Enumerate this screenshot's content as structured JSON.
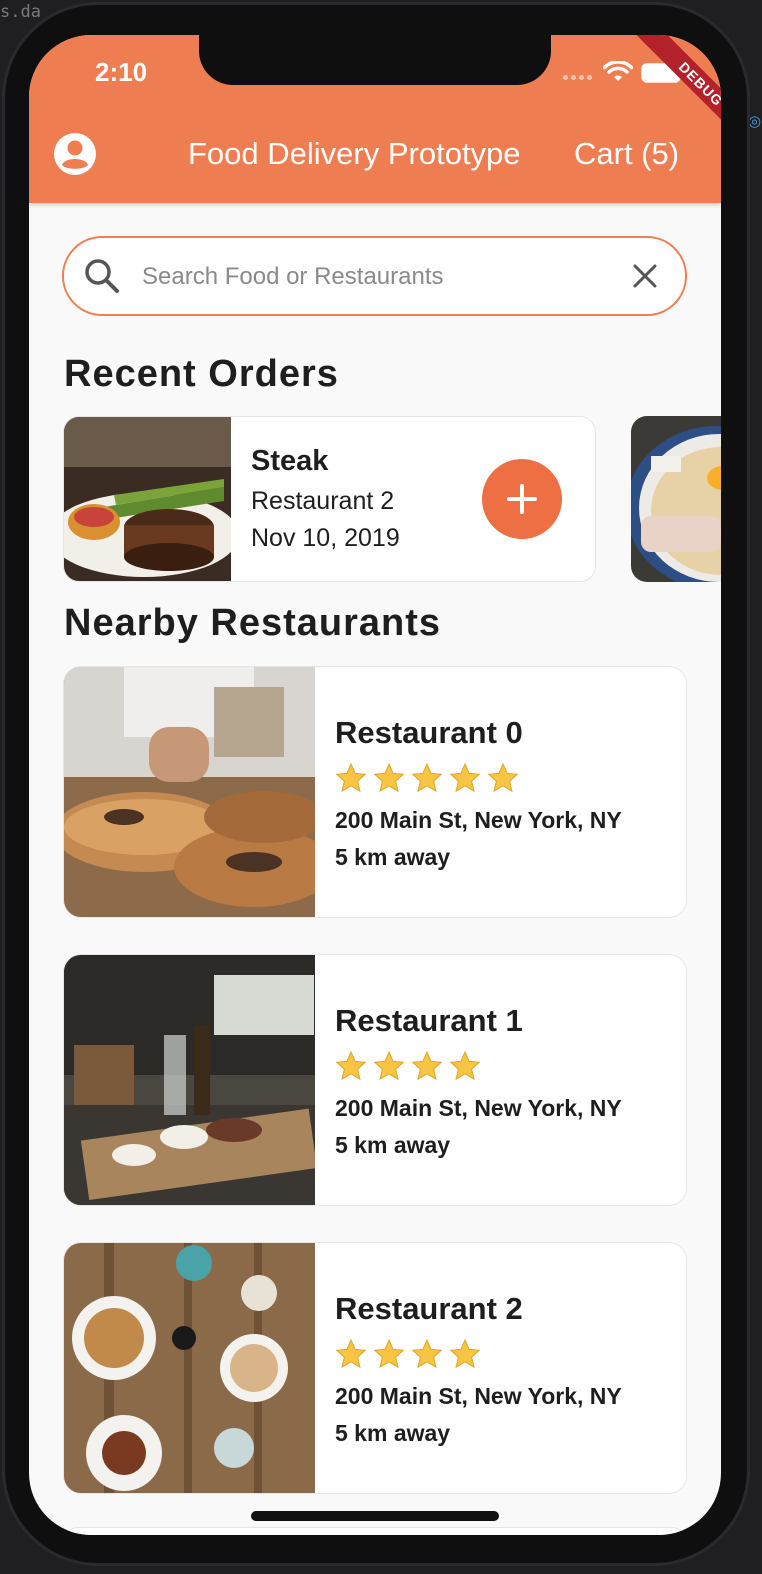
{
  "editor_fragment": "s.da",
  "status": {
    "time": "2:10",
    "debug_banner": "DEBUG"
  },
  "appbar": {
    "title": "Food Delivery Prototype",
    "cart_label": "Cart (5)"
  },
  "search": {
    "placeholder": "Search Food or Restaurants",
    "value": ""
  },
  "recent_orders": {
    "heading": "Recent Orders",
    "items": [
      {
        "name": "Steak",
        "restaurant": "Restaurant 2",
        "date": "Nov 10, 2019"
      }
    ]
  },
  "nearby": {
    "heading": "Nearby Restaurants",
    "items": [
      {
        "name": "Restaurant 0",
        "rating": 5,
        "address": "200 Main St, New York, NY",
        "distance": "5 km away"
      },
      {
        "name": "Restaurant 1",
        "rating": 4,
        "address": "200 Main St, New York, NY",
        "distance": "5 km away"
      },
      {
        "name": "Restaurant 2",
        "rating": 4,
        "address": "200 Main St, New York, NY",
        "distance": "5 km away"
      }
    ]
  },
  "colors": {
    "accent": "#ef7d52",
    "star": "#f6c543",
    "background": "#f9f9f9"
  },
  "icons": [
    "account-icon",
    "search-icon",
    "clear-icon",
    "plus-icon",
    "star-icon",
    "wifi-icon",
    "battery-icon"
  ]
}
